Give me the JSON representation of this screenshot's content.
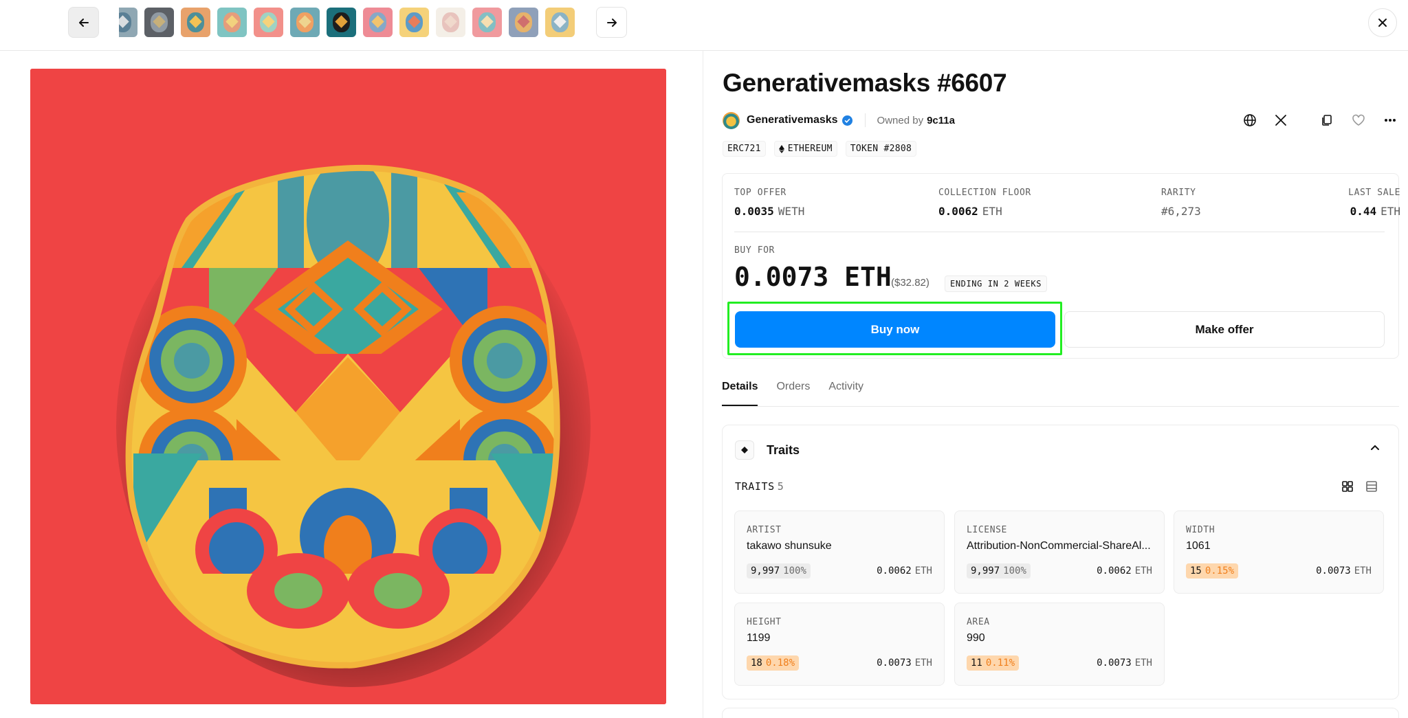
{
  "nft": {
    "title": "Generativemasks #6607",
    "collection": "Generativemasks",
    "owned_by_label": "Owned by",
    "owner": "9c11a",
    "chips": [
      "ERC721",
      "ETHEREUM",
      "TOKEN #2808"
    ]
  },
  "stats": {
    "top_offer": {
      "label": "TOP OFFER",
      "value": "0.0035",
      "unit": "WETH"
    },
    "floor": {
      "label": "COLLECTION FLOOR",
      "value": "0.0062",
      "unit": "ETH"
    },
    "rarity": {
      "label": "RARITY",
      "value": "#6,273"
    },
    "last_sale": {
      "label": "LAST SALE",
      "value": "0.44",
      "unit": "ETH"
    }
  },
  "buy": {
    "label": "BUY FOR",
    "price": "0.0073 ETH",
    "usd": "($32.82)",
    "ending": "ENDING IN 2 WEEKS",
    "buy_now": "Buy now",
    "make_offer": "Make offer"
  },
  "tabs": [
    "Details",
    "Orders",
    "Activity"
  ],
  "traits_section": {
    "title": "Traits",
    "count_label": "TRAITS",
    "count": "5",
    "items": [
      {
        "type": "ARTIST",
        "value": "takawo shunsuke",
        "count": "9,997",
        "pct": "100%",
        "floor": "0.0062",
        "unit": "ETH",
        "rare": false
      },
      {
        "type": "LICENSE",
        "value": "Attribution-NonCommercial-ShareAl...",
        "count": "9,997",
        "pct": "100%",
        "floor": "0.0062",
        "unit": "ETH",
        "rare": false
      },
      {
        "type": "WIDTH",
        "value": "1061",
        "count": "15",
        "pct": "0.15%",
        "floor": "0.0073",
        "unit": "ETH",
        "rare": true
      },
      {
        "type": "HEIGHT",
        "value": "1199",
        "count": "18",
        "pct": "0.18%",
        "floor": "0.0073",
        "unit": "ETH",
        "rare": true
      },
      {
        "type": "AREA",
        "value": "990",
        "count": "11",
        "pct": "0.11%",
        "floor": "0.0073",
        "unit": "ETH",
        "rare": true
      }
    ]
  },
  "icons": [
    "arrow-left-icon",
    "arrow-right-icon",
    "close-icon",
    "verified-icon",
    "globe-icon",
    "x-logo-icon",
    "copy-icon",
    "heart-icon",
    "more-icon",
    "diamond-icon",
    "chevron-up-icon",
    "grid-view-icon",
    "list-view-icon"
  ],
  "colors": {
    "accent": "#0086ff",
    "artwork_bg": "#ef4444",
    "highlight": "#22ee22",
    "rare_badge": "#fed7ad"
  },
  "thumbnails": [
    {
      "bg": "#8fa7b3",
      "a": "#5a7f95",
      "b": "#d9dde0"
    },
    {
      "bg": "#5c6066",
      "a": "#909aa3",
      "b": "#c7b07a"
    },
    {
      "bg": "#e8a26b",
      "a": "#4d8f99",
      "b": "#f3c255"
    },
    {
      "bg": "#7fc4c2",
      "a": "#e59d7b",
      "b": "#f2d27e"
    },
    {
      "bg": "#f2908a",
      "a": "#9fd2c3",
      "b": "#f6d37c"
    },
    {
      "bg": "#6ea9b5",
      "a": "#f0a062",
      "b": "#eed48f"
    },
    {
      "bg": "#1b6f7b",
      "a": "#1d1d1d",
      "b": "#e2a13a"
    },
    {
      "bg": "#ee8b95",
      "a": "#86a8c7",
      "b": "#f2c46e"
    },
    {
      "bg": "#f5d27a",
      "a": "#5d9bc7",
      "b": "#e87d5b"
    },
    {
      "bg": "#f4efe7",
      "a": "#e8c3bd",
      "b": "#f0d9cc"
    },
    {
      "bg": "#f09a9e",
      "a": "#83bfc4",
      "b": "#f6dfb1"
    },
    {
      "bg": "#8fa0b9",
      "a": "#e6b26b",
      "b": "#cf6e6e"
    },
    {
      "bg": "#f3cd78",
      "a": "#8bb3c5",
      "b": "#efefef"
    }
  ]
}
